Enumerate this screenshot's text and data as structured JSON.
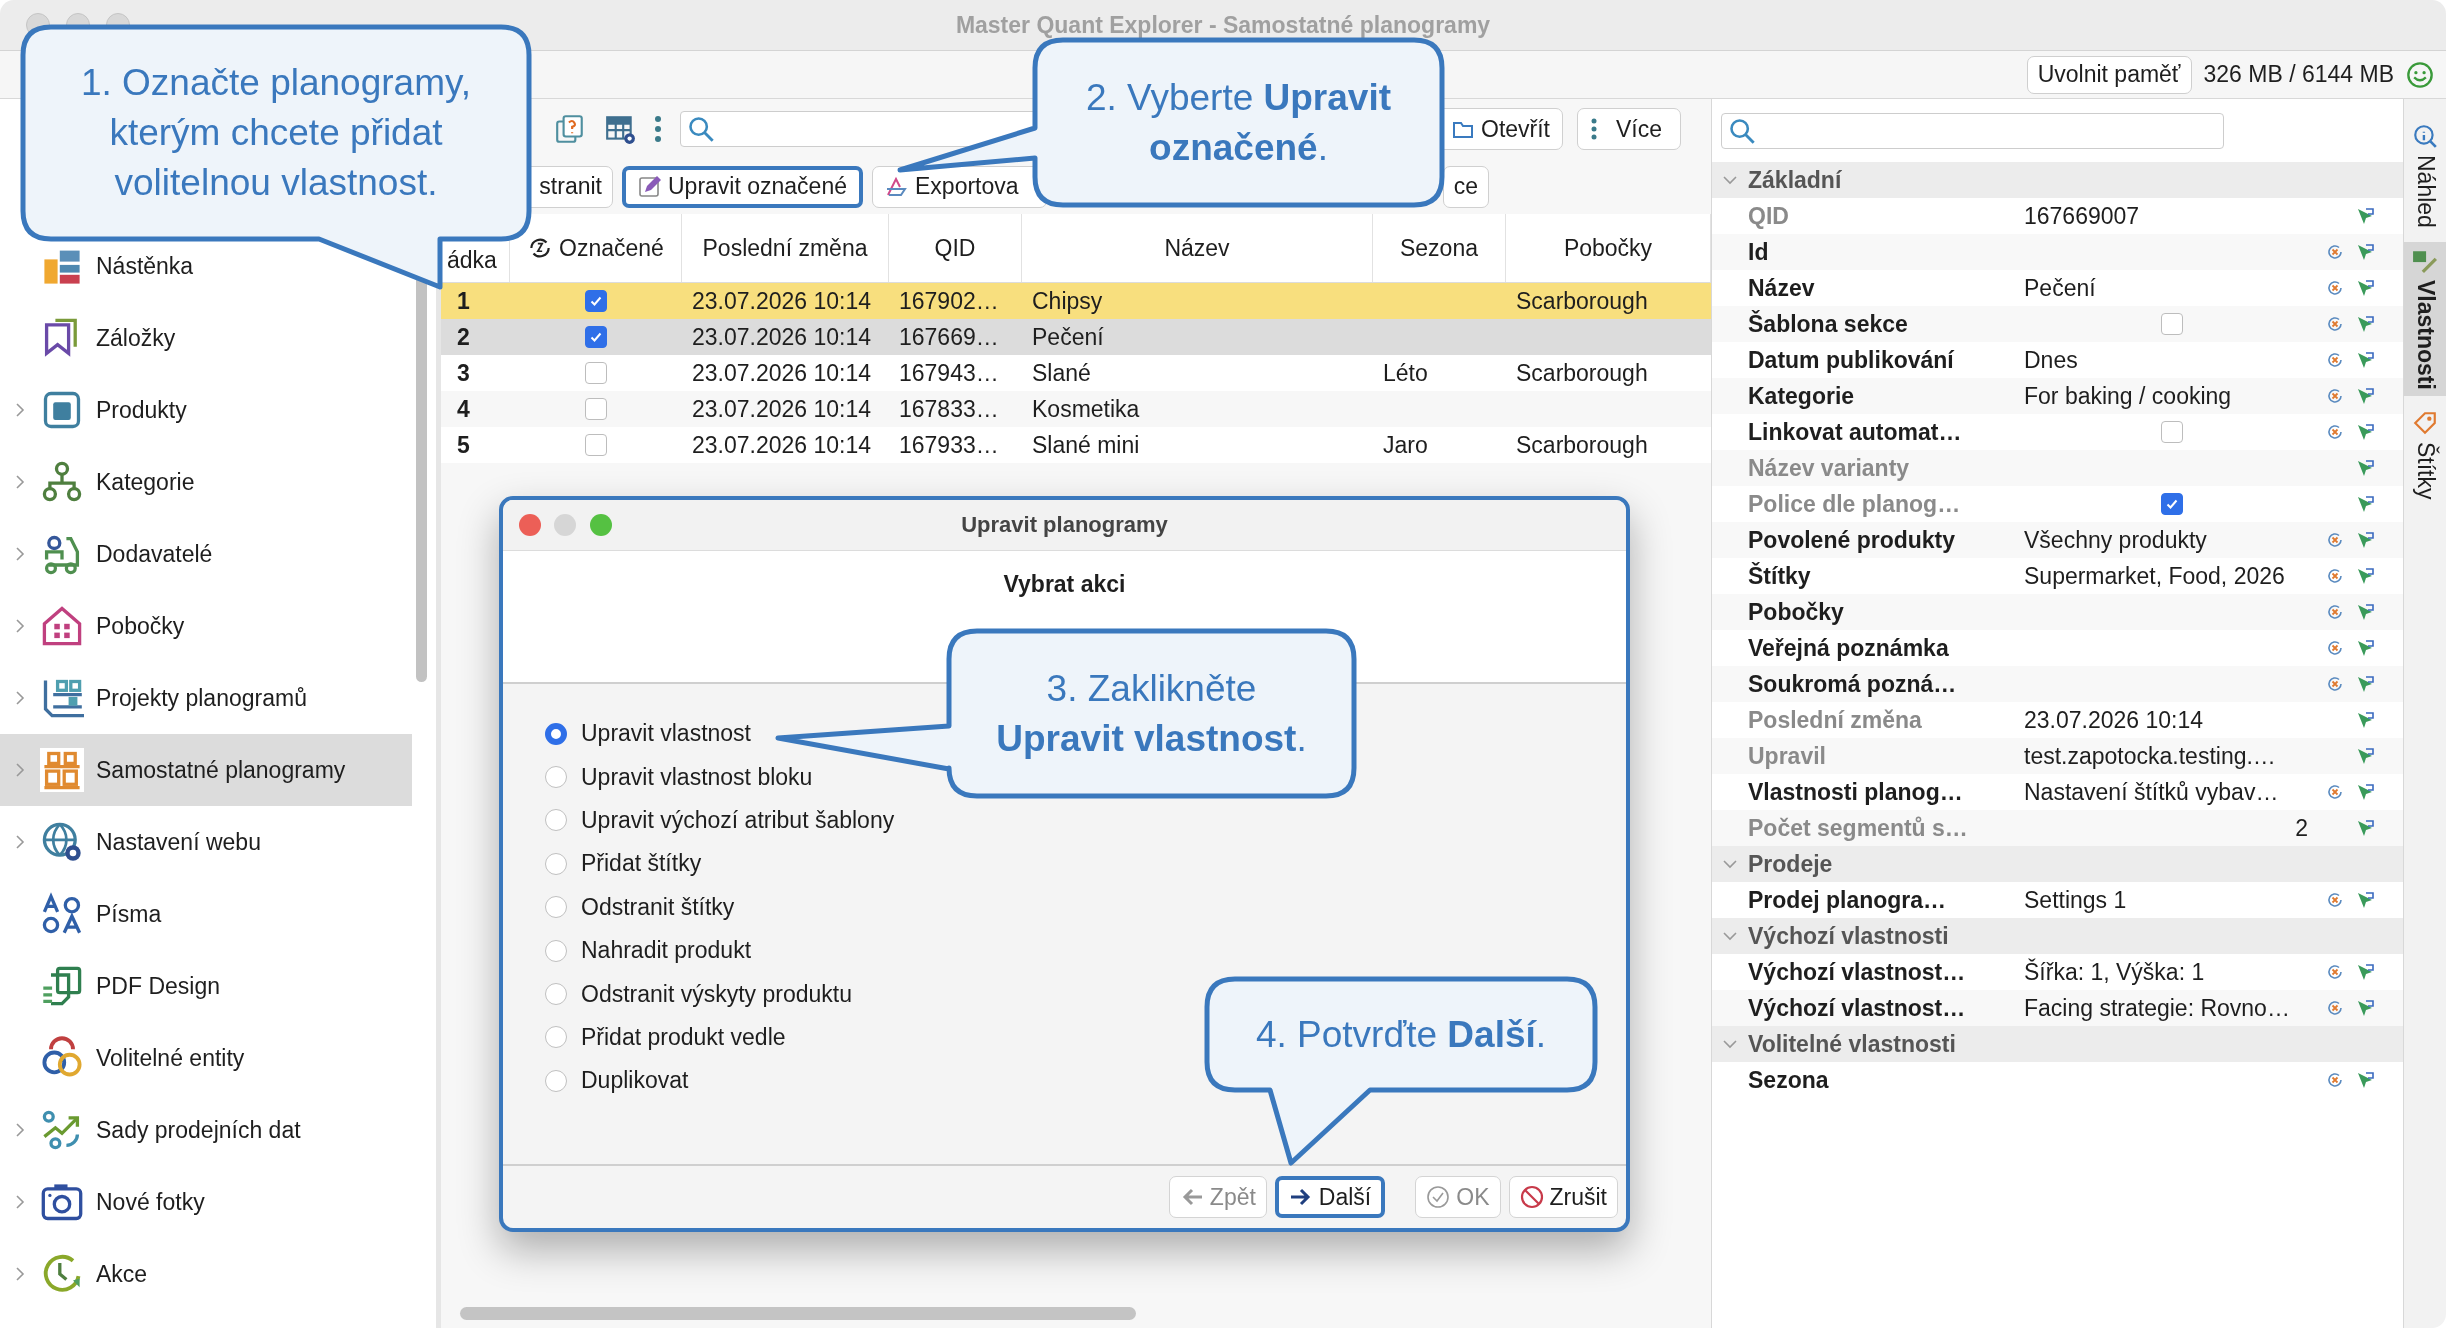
{
  "window": {
    "title": "Master Quant Explorer - Samostatné planogramy"
  },
  "memory": {
    "button": "Uvolnit paměť",
    "usage": "326 MB / 6144 MB"
  },
  "sidebar": {
    "items": [
      {
        "label": "Nástěnka",
        "expandable": false,
        "selected": false
      },
      {
        "label": "Záložky",
        "expandable": false,
        "selected": false
      },
      {
        "label": "Produkty",
        "expandable": true,
        "selected": false
      },
      {
        "label": "Kategorie",
        "expandable": true,
        "selected": false
      },
      {
        "label": "Dodavatelé",
        "expandable": true,
        "selected": false
      },
      {
        "label": "Pobočky",
        "expandable": true,
        "selected": false
      },
      {
        "label": "Projekty planogramů",
        "expandable": true,
        "selected": false
      },
      {
        "label": "Samostatné planogramy",
        "expandable": true,
        "selected": true
      },
      {
        "label": "Nastavení webu",
        "expandable": true,
        "selected": false
      },
      {
        "label": "Písma",
        "expandable": false,
        "selected": false
      },
      {
        "label": "PDF Design",
        "expandable": false,
        "selected": false
      },
      {
        "label": "Volitelné entity",
        "expandable": false,
        "selected": false
      },
      {
        "label": "Sady prodejních dat",
        "expandable": true,
        "selected": false
      },
      {
        "label": "Nové fotky",
        "expandable": true,
        "selected": false
      },
      {
        "label": "Akce",
        "expandable": true,
        "selected": false
      }
    ]
  },
  "toolbar": {
    "open_button": "Otevřít",
    "more_button": "Více",
    "remove_button": "stranit",
    "edit_button": {
      "label": "Upravit označené",
      "highlighted": true
    },
    "export_button": "Exportova",
    "button_4": "ce"
  },
  "table": {
    "columns": [
      "ádka",
      "Označené",
      "Poslední změna",
      "QID",
      "Název",
      "Sezona",
      "Pobočky"
    ],
    "rows": [
      {
        "number": "1",
        "checked": true,
        "modified": "23.07.2026 10:14",
        "qid": "167902…",
        "name": "Chipsy",
        "branches": "Scarborough",
        "selected": true,
        "focused": true
      },
      {
        "number": "2",
        "checked": true,
        "modified": "23.07.2026 10:14",
        "qid": "167669…",
        "name": "Pečení",
        "selected": true,
        "focused": false
      },
      {
        "number": "3",
        "checked": false,
        "modified": "23.07.2026 10:14",
        "qid": "167943…",
        "name": "Slané",
        "season": "Léto",
        "branches": "Scarborough",
        "selected": false,
        "focused": false
      },
      {
        "number": "4",
        "checked": false,
        "modified": "23.07.2026 10:14",
        "qid": "167833…",
        "name": "Kosmetika",
        "selected": false,
        "focused": false
      },
      {
        "number": "5",
        "checked": false,
        "modified": "23.07.2026 10:14",
        "qid": "167933…",
        "name": "Slané mini",
        "season": "Jaro",
        "branches": "Scarborough",
        "selected": false,
        "focused": false
      }
    ]
  },
  "dialog": {
    "title": "Upravit planogramy",
    "heading": "Vybrat akci",
    "options": [
      {
        "label": "Upravit vlastnost",
        "selected": true
      },
      {
        "label": "Upravit vlastnost bloku",
        "selected": false
      },
      {
        "label": "Upravit výchozí atribut šablony",
        "selected": false
      },
      {
        "label": "Přidat štítky",
        "selected": false
      },
      {
        "label": "Odstranit štítky",
        "selected": false
      },
      {
        "label": "Nahradit produkt",
        "selected": false
      },
      {
        "label": "Odstranit výskyty produktu",
        "selected": false
      },
      {
        "label": "Přidat produkt vedle",
        "selected": false
      },
      {
        "label": "Duplikovat",
        "selected": false
      }
    ],
    "buttons": [
      {
        "label": "Zpět",
        "disabled": true,
        "highlighted": false
      },
      {
        "label": "Další",
        "disabled": false,
        "highlighted": true
      },
      {
        "label": "OK",
        "disabled": true,
        "highlighted": false
      },
      {
        "label": "Zrušit",
        "disabled": false,
        "highlighted": false
      }
    ]
  },
  "properties": {
    "groups": [
      {
        "title": "Základní",
        "expanded": true,
        "rows": [
          {
            "label": "QID",
            "kind": "text",
            "value": "167669007",
            "readonly": true
          },
          {
            "label": "Id",
            "kind": "text",
            "readonly": false
          },
          {
            "label": "Název",
            "kind": "text",
            "value": "Pečení",
            "readonly": false
          },
          {
            "label": "Šablona sekce",
            "kind": "checkbox",
            "checked": false,
            "readonly": false
          },
          {
            "label": "Datum publikování",
            "kind": "text",
            "value": "Dnes",
            "readonly": false
          },
          {
            "label": "Kategorie",
            "kind": "text",
            "value": "For baking / cooking",
            "readonly": false
          },
          {
            "label": "Linkovat automat…",
            "kind": "checkbox",
            "checked": false,
            "readonly": false
          },
          {
            "label": "Název varianty",
            "kind": "text",
            "readonly": true
          },
          {
            "label": "Police dle planog…",
            "kind": "checkbox",
            "checked": true,
            "readonly": true
          },
          {
            "label": "Povolené produkty",
            "kind": "text",
            "value": "Všechny produkty",
            "readonly": false
          },
          {
            "label": "Štítky",
            "kind": "text",
            "value": "Supermarket, Food, 2026",
            "readonly": false
          },
          {
            "label": "Pobočky",
            "kind": "text",
            "readonly": false
          },
          {
            "label": "Veřejná poznámka",
            "kind": "text",
            "readonly": false
          },
          {
            "label": "Soukromá pozná…",
            "kind": "text",
            "readonly": false
          },
          {
            "label": "Poslední změna",
            "kind": "text",
            "value": "23.07.2026 10:14",
            "readonly": true
          },
          {
            "label": "Upravil",
            "kind": "text",
            "value": "test.zapotocka.testing.…",
            "readonly": true
          },
          {
            "label": "Vlastnosti planog…",
            "kind": "text",
            "value": "Nastavení štítků vybav…",
            "readonly": false
          },
          {
            "label": "Počet segmentů s…",
            "kind": "number",
            "value": "2",
            "readonly": true
          }
        ]
      },
      {
        "title": "Prodeje",
        "expanded": true,
        "rows": [
          {
            "label": "Prodej planogra…",
            "kind": "text",
            "value": "Settings 1",
            "readonly": false
          }
        ]
      },
      {
        "title": "Výchozí vlastnosti",
        "expanded": true,
        "rows": [
          {
            "label": "Výchozí vlastnost…",
            "kind": "text",
            "value": "Šířka: 1, Výška: 1",
            "readonly": false
          },
          {
            "label": "Výchozí vlastnost…",
            "kind": "text",
            "value": "Facing strategie: Rovno…",
            "readonly": false
          }
        ]
      },
      {
        "title": "Volitelné vlastnosti",
        "expanded": true,
        "rows": [
          {
            "label": "Sezona",
            "kind": "text",
            "readonly": false
          }
        ]
      }
    ]
  },
  "side_tabs": [
    {
      "label": "Náhled",
      "selected": false
    },
    {
      "label": "Vlastnosti",
      "selected": true
    },
    {
      "label": "Štítky",
      "selected": false
    }
  ],
  "callouts": [
    {
      "text": "1. Označte planogramy, kterým chcete přidat volitelnou vlastnost."
    },
    {
      "text": "2. Vyberte **Upravit označené**."
    },
    {
      "text": "3. Zaklikněte **Upravit vlastnost**."
    },
    {
      "text": "4. Potvrďte **Další**."
    }
  ]
}
